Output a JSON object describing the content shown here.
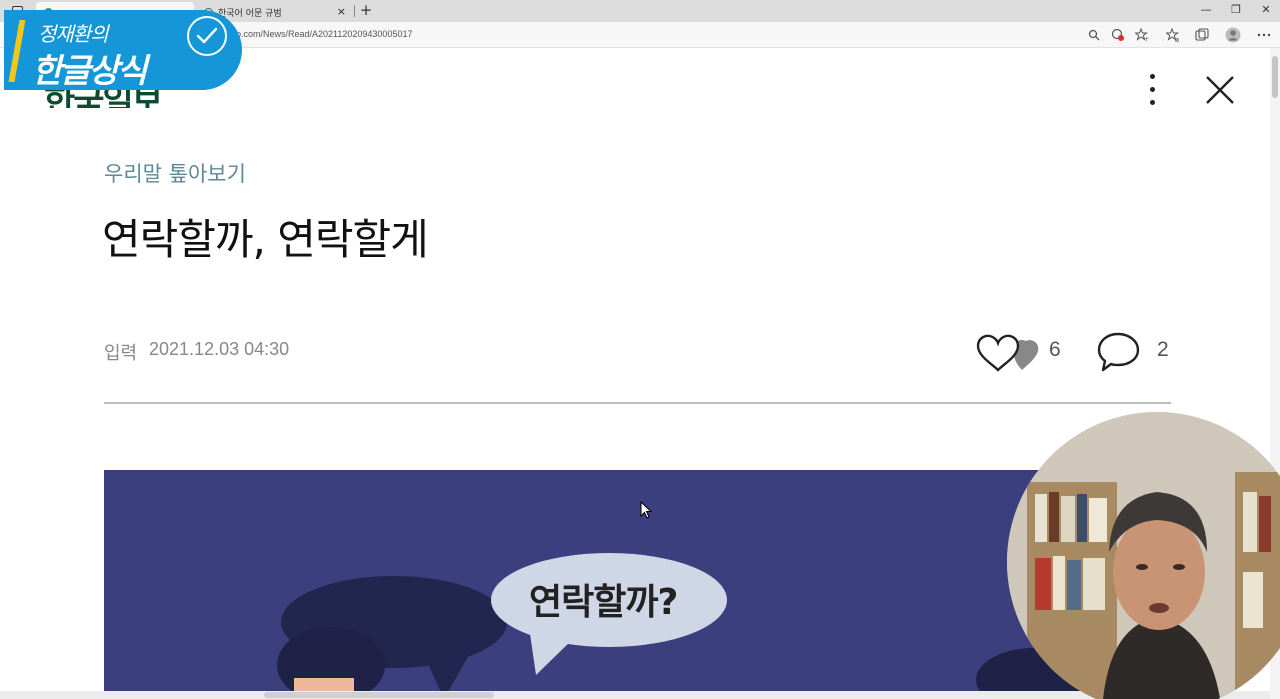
{
  "browser": {
    "tabs": [
      {
        "title": "",
        "active": true
      },
      {
        "title": "한국어 어문 규범",
        "active": false
      }
    ],
    "new_tab": "+",
    "close_tab": "×",
    "url": "o.com/News/Read/A2021120209430005017",
    "window_controls": {
      "minimize": "—",
      "restore": "❐",
      "close": "✕"
    }
  },
  "brand_overlay": {
    "name": "정재환의",
    "title": "한글상식"
  },
  "article": {
    "publisher_logo": "한국일보",
    "section": "우리말 톺아보기",
    "title": "연락할까, 연락할게",
    "meta_label": "입력",
    "date": "2021.12.03 04:30",
    "likes": "6",
    "comments": "2"
  },
  "illustration": {
    "speech_bubble": "연락할까?"
  },
  "colors": {
    "brand_blue": "#1596d8",
    "brand_yellow": "#f5c518",
    "section_teal": "#5e8a98",
    "logo_green": "#0d4a30",
    "illus_bg": "#3b3f7e"
  }
}
